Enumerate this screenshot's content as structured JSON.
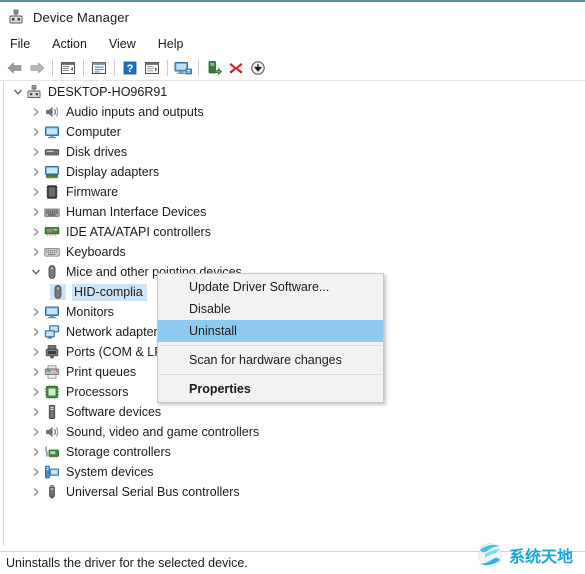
{
  "window": {
    "title": "Device Manager",
    "app_icon": "device-manager-icon",
    "accent_color": "#5f8d9c"
  },
  "menubar": {
    "items": [
      {
        "label": "File"
      },
      {
        "label": "Action"
      },
      {
        "label": "View"
      },
      {
        "label": "Help"
      }
    ]
  },
  "toolbar": {
    "buttons": [
      {
        "name": "back-button",
        "icon": "back-arrow-icon"
      },
      {
        "name": "forward-button",
        "icon": "forward-arrow-icon"
      },
      {
        "name": "separator-1",
        "icon": "separator"
      },
      {
        "name": "show-hide-console-tree-button",
        "icon": "console-tree-icon"
      },
      {
        "name": "separator-2",
        "icon": "separator"
      },
      {
        "name": "properties-button",
        "icon": "properties-window-icon"
      },
      {
        "name": "separator-3",
        "icon": "separator"
      },
      {
        "name": "help-button",
        "icon": "help-question-icon"
      },
      {
        "name": "export-list-button",
        "icon": "export-list-icon"
      },
      {
        "name": "separator-4",
        "icon": "separator"
      },
      {
        "name": "scan-hardware-changes-button",
        "icon": "scan-monitor-icon"
      },
      {
        "name": "separator-5",
        "icon": "separator"
      },
      {
        "name": "update-driver-button",
        "icon": "update-driver-icon"
      },
      {
        "name": "uninstall-device-button",
        "icon": "red-x-icon"
      },
      {
        "name": "disable-device-button",
        "icon": "down-arrow-circle-icon"
      }
    ]
  },
  "tree": {
    "root": {
      "label": "DESKTOP-HO96R91",
      "icon": "computer-root-icon",
      "expanded": true
    },
    "nodes": [
      {
        "label": "Audio inputs and outputs",
        "icon": "speaker-icon",
        "expanded": false,
        "depth": 1
      },
      {
        "label": "Computer",
        "icon": "monitor-icon",
        "expanded": false,
        "depth": 1
      },
      {
        "label": "Disk drives",
        "icon": "disk-drive-icon",
        "expanded": false,
        "depth": 1
      },
      {
        "label": "Display adapters",
        "icon": "display-adapter-icon",
        "expanded": false,
        "depth": 1
      },
      {
        "label": "Firmware",
        "icon": "firmware-chip-icon",
        "expanded": false,
        "depth": 1
      },
      {
        "label": "Human Interface Devices",
        "icon": "hid-keyboard-icon",
        "expanded": false,
        "depth": 1
      },
      {
        "label": "IDE ATA/ATAPI controllers",
        "icon": "ide-controller-icon",
        "expanded": false,
        "depth": 1
      },
      {
        "label": "Keyboards",
        "icon": "keyboard-icon",
        "expanded": false,
        "depth": 1
      },
      {
        "label": "Mice and other pointing devices",
        "icon": "mouse-icon",
        "expanded": true,
        "depth": 1
      },
      {
        "label": "HID-complia",
        "icon": "mouse-icon",
        "expanded": null,
        "depth": 2,
        "selected": true
      },
      {
        "label": "Monitors",
        "icon": "monitor-icon",
        "expanded": false,
        "depth": 1
      },
      {
        "label": "Network adapter",
        "icon": "network-adapter-icon",
        "expanded": false,
        "depth": 1
      },
      {
        "label": "Ports (COM & LF",
        "icon": "port-icon",
        "expanded": false,
        "depth": 1
      },
      {
        "label": "Print queues",
        "icon": "printer-icon",
        "expanded": false,
        "depth": 1
      },
      {
        "label": "Processors",
        "icon": "processor-icon",
        "expanded": false,
        "depth": 1
      },
      {
        "label": "Software devices",
        "icon": "software-device-icon",
        "expanded": false,
        "depth": 1
      },
      {
        "label": "Sound, video and game controllers",
        "icon": "speaker-icon",
        "expanded": false,
        "depth": 1
      },
      {
        "label": "Storage controllers",
        "icon": "storage-controller-icon",
        "expanded": false,
        "depth": 1
      },
      {
        "label": "System devices",
        "icon": "system-device-icon",
        "expanded": false,
        "depth": 1
      },
      {
        "label": "Universal Serial Bus controllers",
        "icon": "usb-controller-icon",
        "expanded": false,
        "depth": 1
      }
    ]
  },
  "context_menu": {
    "highlight_color": "#8ecaf0",
    "items": [
      {
        "label": "Update Driver Software...",
        "type": "item"
      },
      {
        "label": "Disable",
        "type": "item"
      },
      {
        "label": "Uninstall",
        "type": "item",
        "highlighted": true
      },
      {
        "type": "separator"
      },
      {
        "label": "Scan for hardware changes",
        "type": "item"
      },
      {
        "type": "separator"
      },
      {
        "label": "Properties",
        "type": "item",
        "bold": true
      }
    ]
  },
  "statusbar": {
    "text": "Uninstalls the driver for the selected device."
  },
  "watermark": {
    "text": "系统天地",
    "color": "#19a8dd",
    "logo_icon": "circular-swoosh-logo-icon"
  }
}
